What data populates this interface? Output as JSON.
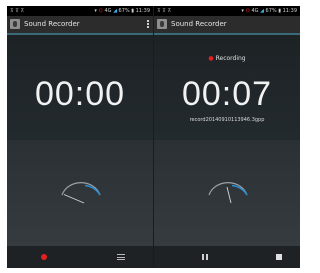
{
  "left": {
    "status": {
      "left": "⊼ ⊼ ⊼",
      "right_prefix": "▾ ",
      "right_red": "⌬",
      "right_mid": " 4G ",
      "right_blue": "◢",
      "right_suffix": " 67% ▮ 11:39"
    },
    "app_title": "Sound Recorder",
    "timer": "00:00",
    "icons": [
      "app-icon",
      "overflow-menu-icon",
      "vu-meter-icon",
      "record-icon",
      "list-icon"
    ],
    "colors": {
      "record": "#e52020",
      "accent": "#33b5e5"
    }
  },
  "right": {
    "status": {
      "left": "⊼ ⊼ ⊼",
      "right_prefix": "▾ ",
      "right_red": "⌬",
      "right_mid": " 4G ",
      "right_blue": "◢",
      "right_suffix": " 67% ▮ 11:39"
    },
    "app_title": "Sound Recorder",
    "recording_label": "Recording",
    "timer": "00:07",
    "filename": "record20140910113946.3gpp",
    "icons": [
      "app-icon",
      "recording-dot-icon",
      "vu-meter-icon",
      "pause-icon",
      "stop-icon"
    ]
  }
}
